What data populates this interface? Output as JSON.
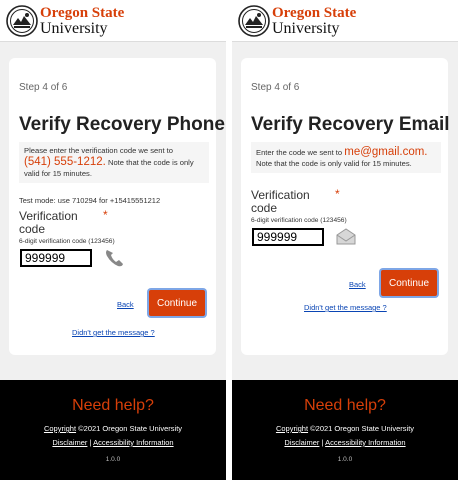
{
  "brand": {
    "name_line1": "Oregon State",
    "name_line2": "University",
    "accent": "#d73f09",
    "link_color": "#0a45b4"
  },
  "left": {
    "step": "Step 4 of 6",
    "title": "Verify Recovery Phone",
    "notice_before": "Please enter the verification code we sent to",
    "notice_highlight": "(541) 555-1212.",
    "notice_after": "Note that the code is only valid for 15 minutes.",
    "test_mode": "Test mode: use 710294 for +15415551212",
    "field_label_1": "Verification",
    "field_label_2": "code",
    "required_mark": "*",
    "field_hint": "6-digit verification code (123456)",
    "code_value": "999999",
    "field_icon": "phone-icon",
    "back_label": "Back",
    "continue_label": "Continue",
    "resend_label": "Didn't get the message ?"
  },
  "right": {
    "step": "Step 4 of 6",
    "title": "Verify Recovery Email",
    "notice_before": "Enter the code we sent to",
    "notice_highlight": "me@gmail.com.",
    "notice_after": "Note that the code is only valid for 15 minutes.",
    "field_label_1": "Verification",
    "field_label_2": "code",
    "required_mark": "*",
    "field_hint": "6-digit verification code (123456)",
    "code_value": "999999",
    "field_icon": "envelope-icon",
    "back_label": "Back",
    "continue_label": "Continue",
    "resend_label": "Didn't get the message ?"
  },
  "footer": {
    "help": "Need help?",
    "copyright_link": "Copyright",
    "copyright_text": "©2021 Oregon State University",
    "disclaimer": "Disclaimer",
    "separator": "|",
    "accessibility": "Accessibility Information",
    "version": "1.0.0"
  }
}
